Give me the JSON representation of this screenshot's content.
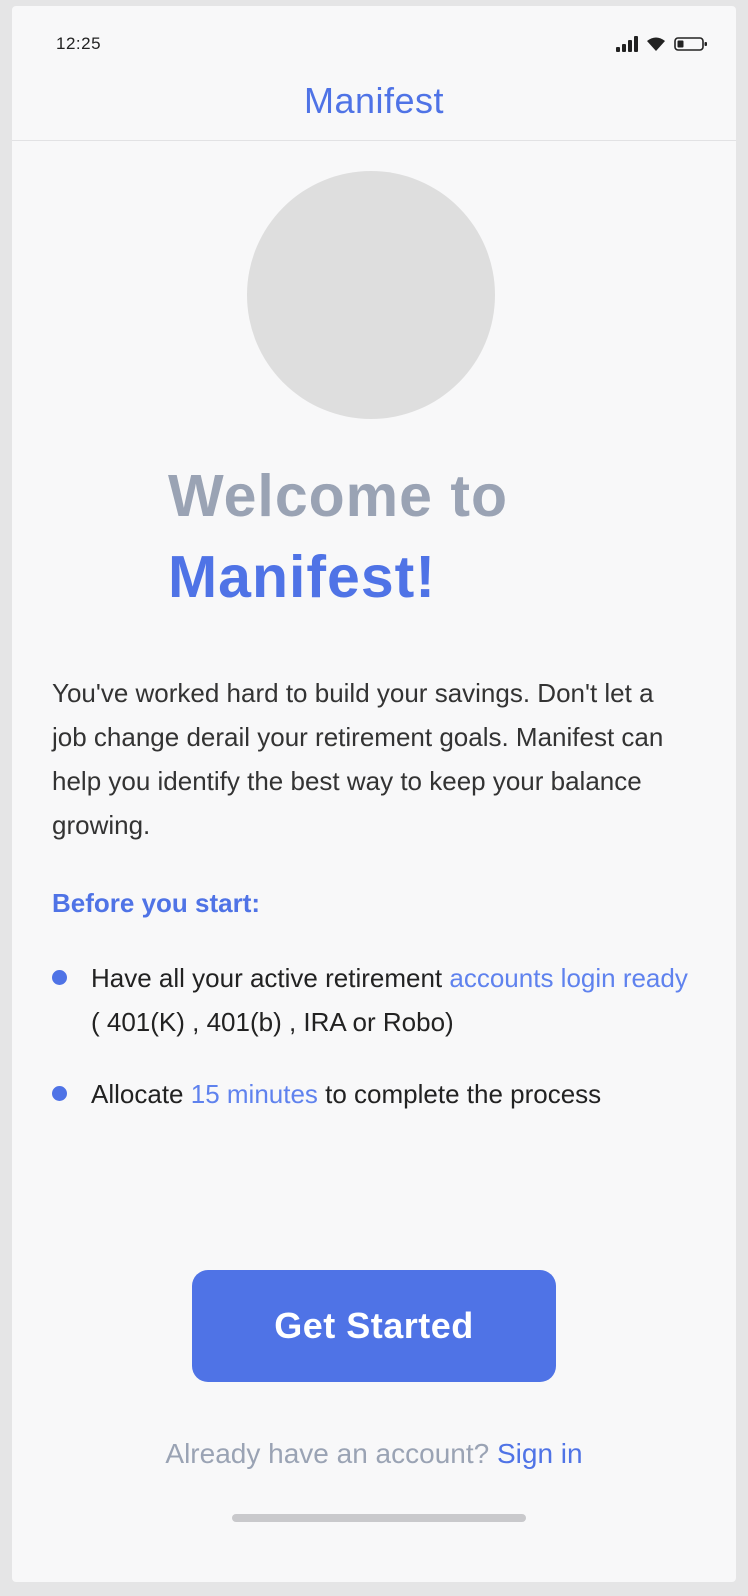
{
  "status_bar": {
    "time": "12:25",
    "icons": [
      "signal-icon",
      "wifi-icon",
      "battery-icon"
    ]
  },
  "header": {
    "title": "Manifest"
  },
  "hero": {
    "image": "placeholder-circle"
  },
  "welcome": {
    "line1": "Welcome to",
    "line2": "Manifest!"
  },
  "intro": {
    "text": "You've worked hard to build your savings. Don't let a job change derail your retirement goals. Manifest can help you identify the best way to keep your balance growing."
  },
  "before_start": {
    "heading": "Before you start:",
    "items": [
      {
        "prefix": "Have all your active retirement ",
        "highlight": "accounts login ready",
        "suffix": " ( 401(K) , 401(b) , IRA or Robo)"
      },
      {
        "prefix": "Allocate ",
        "highlight": "15 minutes",
        "suffix": " to complete the process"
      }
    ]
  },
  "actions": {
    "primary_label": "Get Started",
    "signin_prompt": "Already have an account? ",
    "signin_link": "Sign in"
  },
  "colors": {
    "accent": "#4f73e6",
    "muted": "#9aa3b4",
    "background": "#f8f8f9"
  }
}
